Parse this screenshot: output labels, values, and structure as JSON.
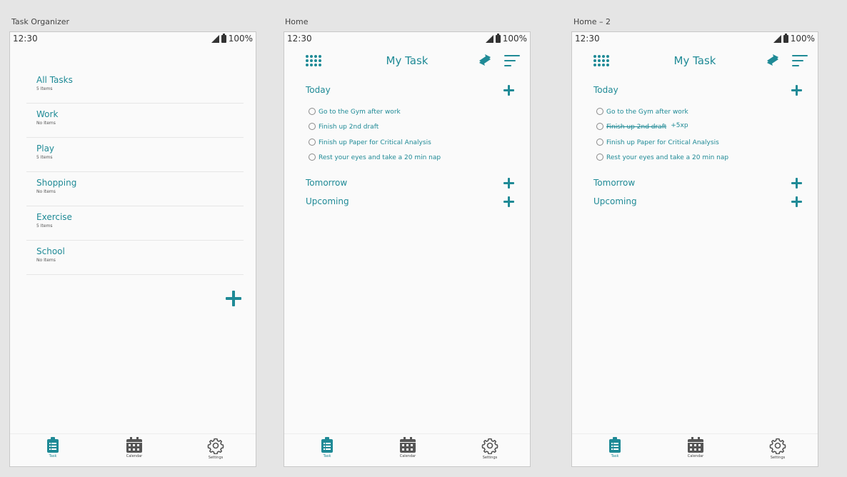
{
  "artboards": {
    "organizer_label": "Task Organizer",
    "home_label": "Home",
    "home2_label": "Home – 2"
  },
  "status": {
    "time": "12:30",
    "battery": "100%"
  },
  "categories": [
    {
      "name": "All Tasks",
      "count": "5 Items"
    },
    {
      "name": "Work",
      "count": "No Items"
    },
    {
      "name": "Play",
      "count": "5 Items"
    },
    {
      "name": "Shopping",
      "count": "No Items"
    },
    {
      "name": "Exercise",
      "count": "5 Items"
    },
    {
      "name": "School",
      "count": "No Items"
    }
  ],
  "home": {
    "title": "My Task",
    "sections": {
      "today": "Today",
      "tomorrow": "Tomorrow",
      "upcoming": "Upcoming"
    },
    "tasks": [
      "Go to the Gym after work",
      "Finish up 2nd draft",
      "Finish up Paper for Critical Analysis",
      "Rest your eyes and take a 20 min nap"
    ],
    "completed_xp": "+5xp"
  },
  "nav": {
    "task": "Task",
    "calendar": "Calendar",
    "settings": "Settings"
  },
  "colors": {
    "accent": "#1f8a96",
    "background": "#e5e5e5",
    "screen": "#fafafa"
  }
}
